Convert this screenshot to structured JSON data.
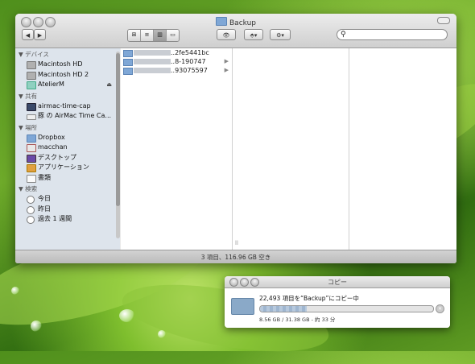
{
  "window": {
    "title": "Backup",
    "statusbar": "3 項目、116.96 GB 空き"
  },
  "toolbar": {
    "back": "◀",
    "forward": "▶",
    "views": [
      "⊞",
      "≡",
      "▥",
      "▭"
    ],
    "quicklook": "👁",
    "dropbox": "⬘▾",
    "action": "⚙▾",
    "search_placeholder": ""
  },
  "sidebar": {
    "sections": [
      {
        "header": "▼ デバイス",
        "items": [
          {
            "label": "Macintosh HD",
            "icon": "hard-drive-icon"
          },
          {
            "label": "Macintosh HD 2",
            "icon": "hard-drive-icon"
          },
          {
            "label": "AtelierM",
            "icon": "disk-icon",
            "eject": "⏏"
          }
        ]
      },
      {
        "header": "▼ 共有",
        "items": [
          {
            "label": "airmac-time-cap",
            "icon": "computer-icon"
          },
          {
            "label": "豚 の AirMac Time Ca...",
            "icon": "time-capsule-icon"
          }
        ]
      },
      {
        "header": "▼ 場所",
        "items": [
          {
            "label": "Dropbox",
            "icon": "folder-icon"
          },
          {
            "label": "macchan",
            "icon": "home-icon"
          },
          {
            "label": "デスクトップ",
            "icon": "desktop-icon"
          },
          {
            "label": "アプリケーション",
            "icon": "applications-icon"
          },
          {
            "label": "書類",
            "icon": "documents-icon"
          }
        ]
      },
      {
        "header": "▼ 検索",
        "items": [
          {
            "label": "今日",
            "icon": "clock-icon"
          },
          {
            "label": "昨日",
            "icon": "clock-icon"
          },
          {
            "label": "過去 1 週間",
            "icon": "clock-icon"
          }
        ]
      }
    ]
  },
  "column1": [
    {
      "label": "..2fe5441bc"
    },
    {
      "label": "..8-190747"
    },
    {
      "label": "..93075597"
    }
  ],
  "copy_dialog": {
    "title": "コピー",
    "message": "22,493 項目を“Backup”にコピー中",
    "stats": "8.56 GB / 31.38 GB - 約 33 分",
    "progress": 0.27
  }
}
